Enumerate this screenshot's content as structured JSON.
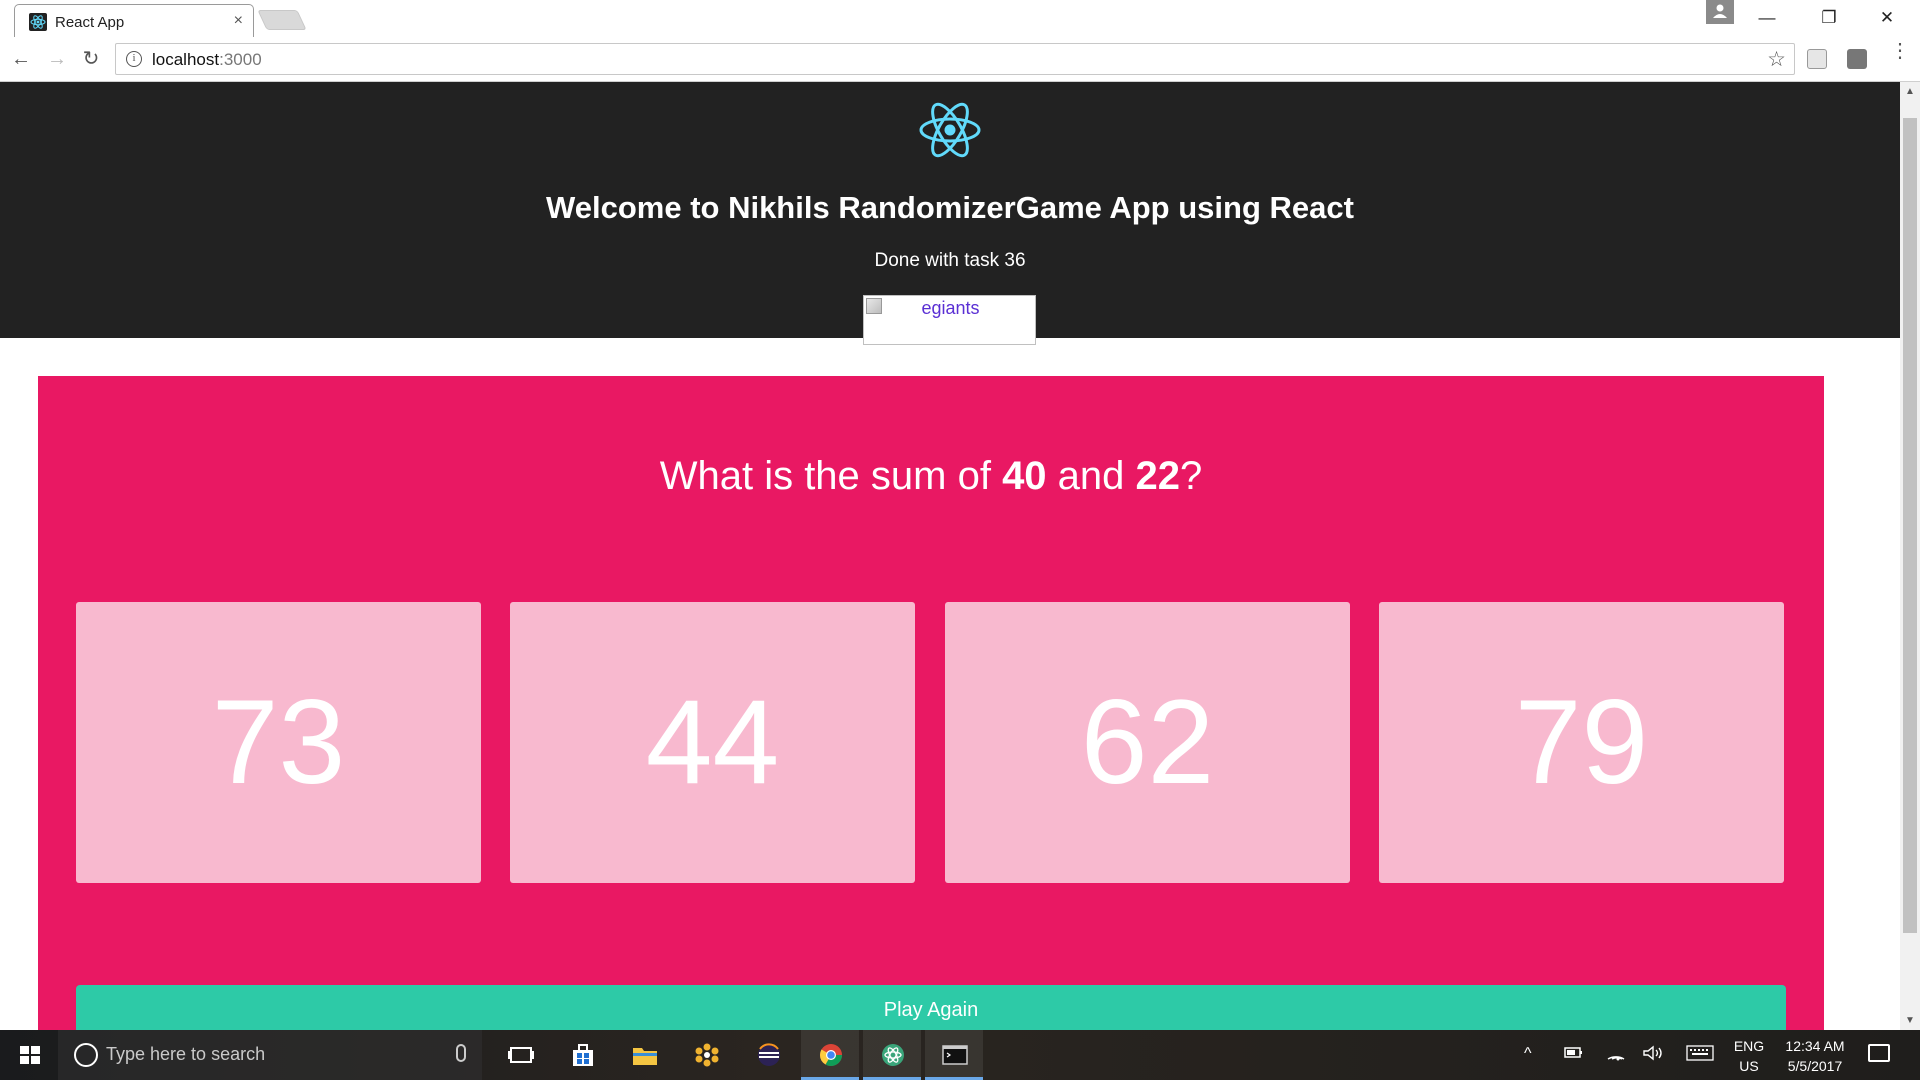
{
  "browser": {
    "tab_title": "React App",
    "tab_close": "×",
    "url_host": "localhost",
    "url_port": ":3000"
  },
  "header": {
    "title": "Welcome to Nikhils RandomizerGame App using React",
    "subtitle": "Done with task 36",
    "image_alt": "egiants"
  },
  "game": {
    "question_prefix": "What is the sum of ",
    "num1": "40",
    "question_mid": " and ",
    "num2": "22",
    "question_suffix": "?",
    "answers": [
      "73",
      "44",
      "62",
      "79"
    ],
    "play_again_label": "Play Again",
    "colors": {
      "panel": "#e91863",
      "answer_box": "#f8b9cf",
      "play_again": "#2dcaa7",
      "header_bg": "#222222",
      "react_blue": "#61dafb"
    }
  },
  "taskbar": {
    "search_placeholder": "Type here to search",
    "language": "ENG",
    "region": "US",
    "time": "12:34 AM",
    "date": "5/5/2017"
  }
}
